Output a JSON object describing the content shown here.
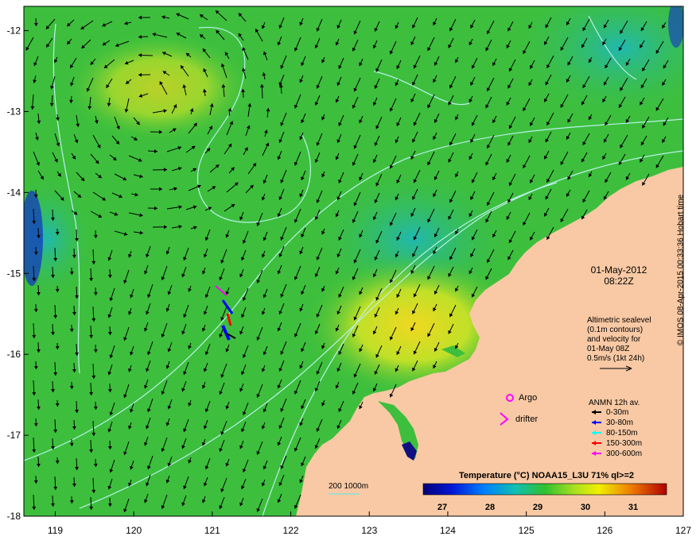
{
  "map": {
    "x_ticks": [
      "119",
      "120",
      "121",
      "122",
      "123",
      "124",
      "125",
      "126",
      "127"
    ],
    "y_ticks": [
      "-12",
      "-13",
      "-14",
      "-15",
      "-16",
      "-17",
      "-18"
    ],
    "xlim": [
      118.6,
      127.0
    ],
    "ylim": [
      -18.0,
      -11.7
    ],
    "colors": {
      "land": "#f8c9a4",
      "sea": "#3dbf3d",
      "contour": "#b8f0e8",
      "arrow": "#000000"
    }
  },
  "annotation": {
    "date": "01-May-2012",
    "time": "08:22Z",
    "altimetry_lines": [
      "Altimetric sealevel",
      "(0.1m contours)",
      "and velocity for",
      "01-May 08Z",
      "0.5m/s (1kt 24h)"
    ]
  },
  "legend": {
    "argo_label": "Argo",
    "drifter_label": "drifter",
    "anmn_title": "ANMN 12h av.",
    "anmn_items": [
      {
        "label": "0-30m",
        "color": "#000000"
      },
      {
        "label": "30-80m",
        "color": "#0000ff"
      },
      {
        "label": "80-150m",
        "color": "#00ffff"
      },
      {
        "label": "150-300m",
        "color": "#ff0000"
      },
      {
        "label": "300-600m",
        "color": "#ff00ff"
      }
    ],
    "depth_label": "200  1000m"
  },
  "colorbar": {
    "title": "Temperature (°C) NOAA15_L3U 71% ql>=2",
    "ticks": [
      "27",
      "28",
      "29",
      "30",
      "31"
    ],
    "range": [
      26.6,
      31.7
    ]
  },
  "credit": "© IMOS 08-Apr-2015 00:33:36 Hobart time"
}
